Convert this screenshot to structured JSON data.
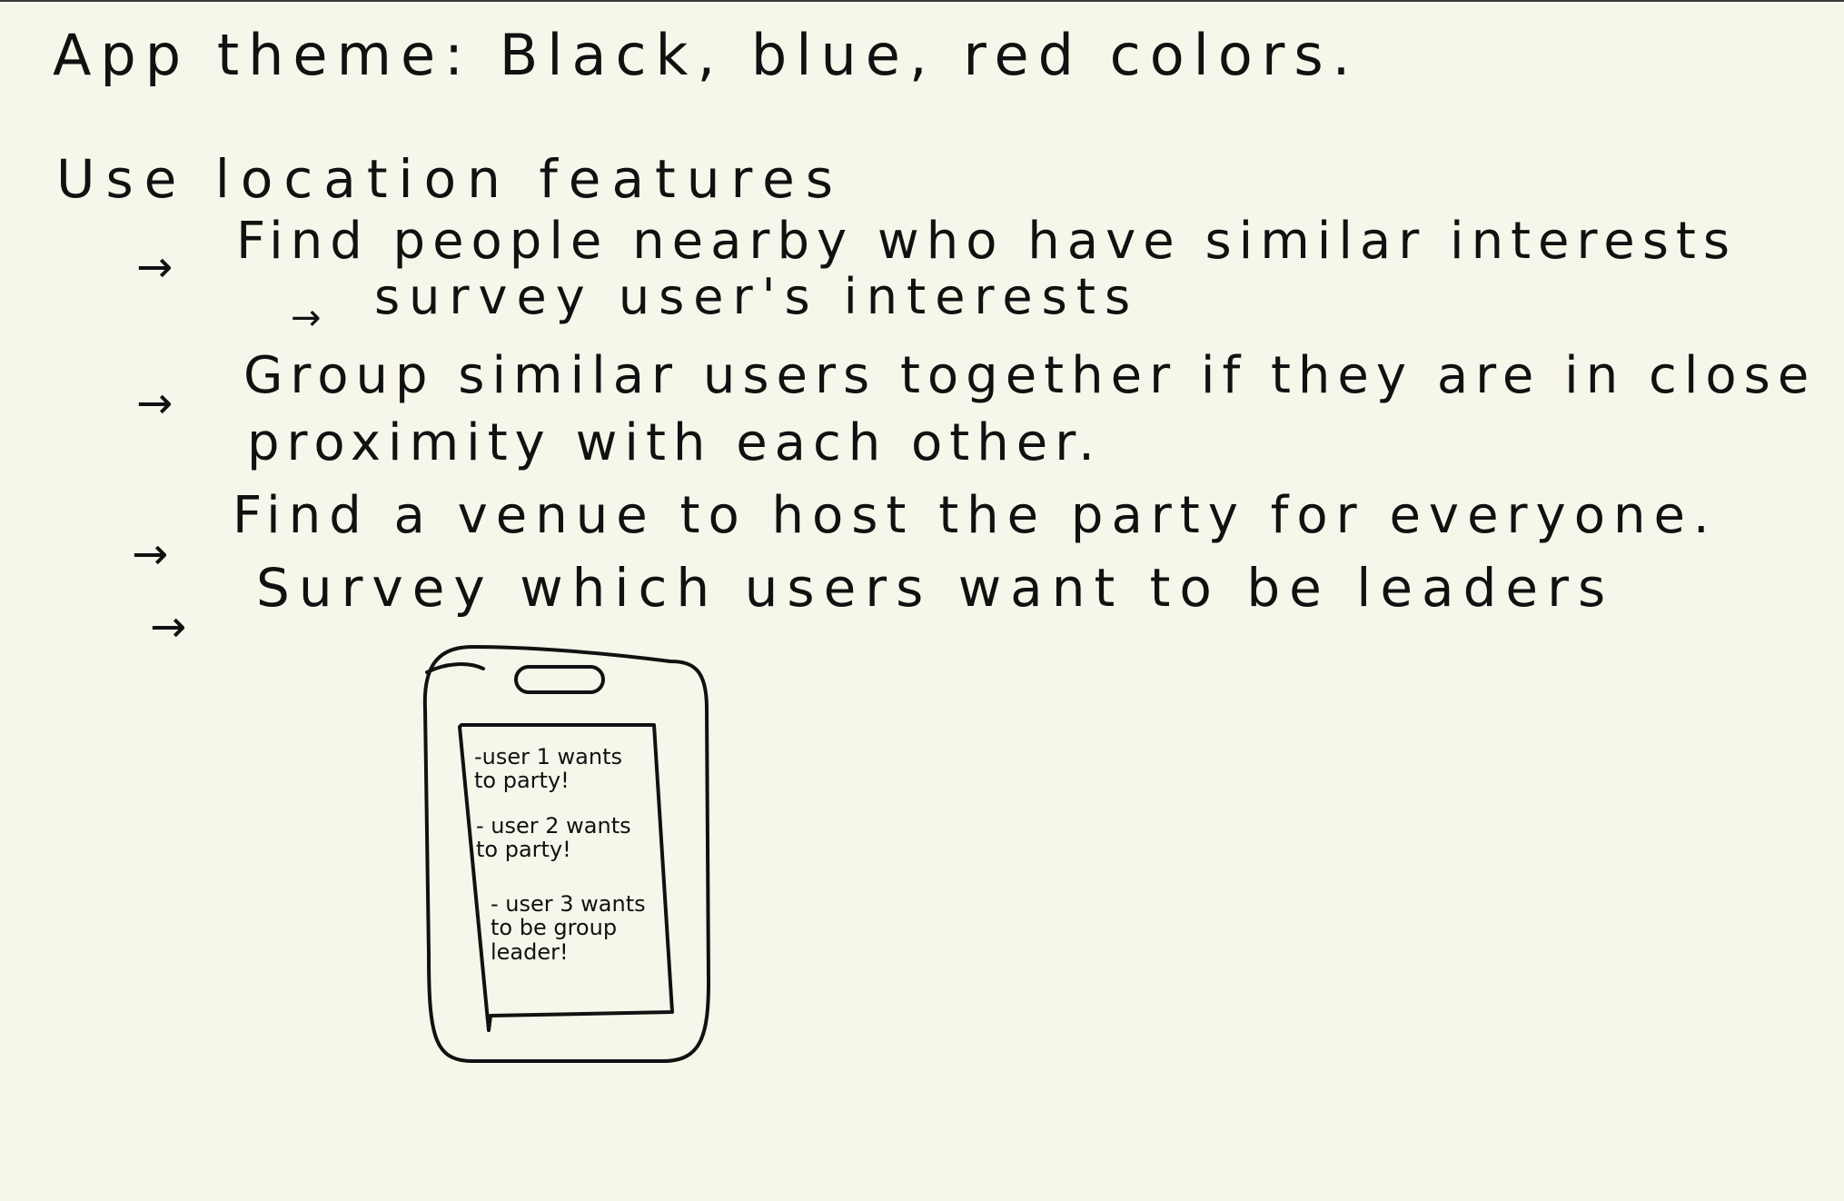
{
  "notes": {
    "theme_line": "App theme: Black, blue, red colors.",
    "heading": "Use location features",
    "items": [
      {
        "arrow": "→",
        "text": "Find people nearby who have similar interests",
        "sub": {
          "arrow": "→",
          "text": "survey user's interests"
        }
      },
      {
        "arrow": "→",
        "text_line1": "Group similar users together if they are in close",
        "text_line2": "proximity with each other."
      },
      {
        "arrow": "→",
        "text": "Find a venue to host the party for everyone."
      },
      {
        "arrow": "→",
        "text": "Survey which users want to be leaders"
      }
    ]
  },
  "phone_sketch": {
    "screen_lines": [
      {
        "line1": "-user 1 wants",
        "line2": "to party!"
      },
      {
        "line1": "- user 2 wants",
        "line2": "to party!"
      },
      {
        "line1": "- user 3 wants",
        "line2": "to be group",
        "line3": "leader!"
      }
    ]
  }
}
